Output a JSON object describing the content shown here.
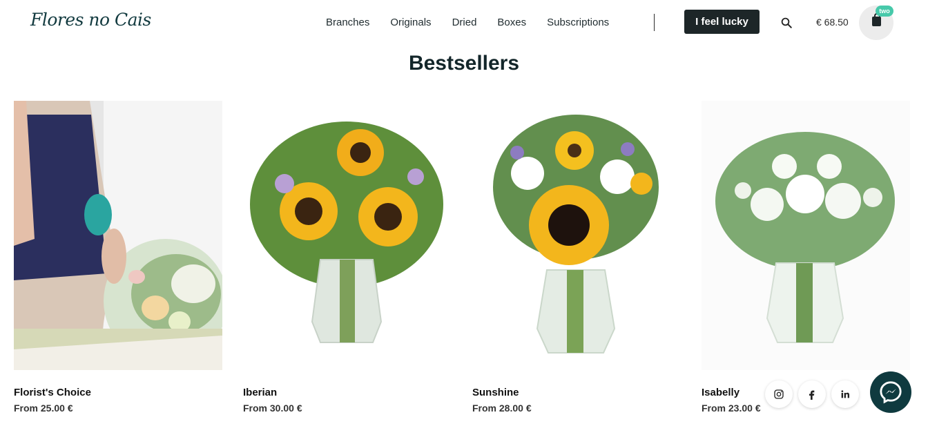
{
  "header": {
    "logo_text": "Flores no Cais",
    "nav": [
      "Branches",
      "Originals",
      "Dried",
      "Boxes",
      "Subscriptions"
    ],
    "lucky_label": "I feel lucky",
    "cart_total": "€ 68.50",
    "cart_badge": "two"
  },
  "section": {
    "title": "Bestsellers"
  },
  "products": [
    {
      "name": "Florist's Choice",
      "price": "From 25.00 €"
    },
    {
      "name": "Iberian",
      "price": "From 30.00 €"
    },
    {
      "name": "Sunshine",
      "price": "From 28.00 €"
    },
    {
      "name": "Isabelly",
      "price": "From 23.00 €"
    }
  ],
  "social": [
    "instagram-icon",
    "facebook-icon",
    "linkedin-icon"
  ],
  "colors": {
    "accent": "#47c9aa",
    "dark": "#1d2628",
    "title": "#13262a"
  }
}
